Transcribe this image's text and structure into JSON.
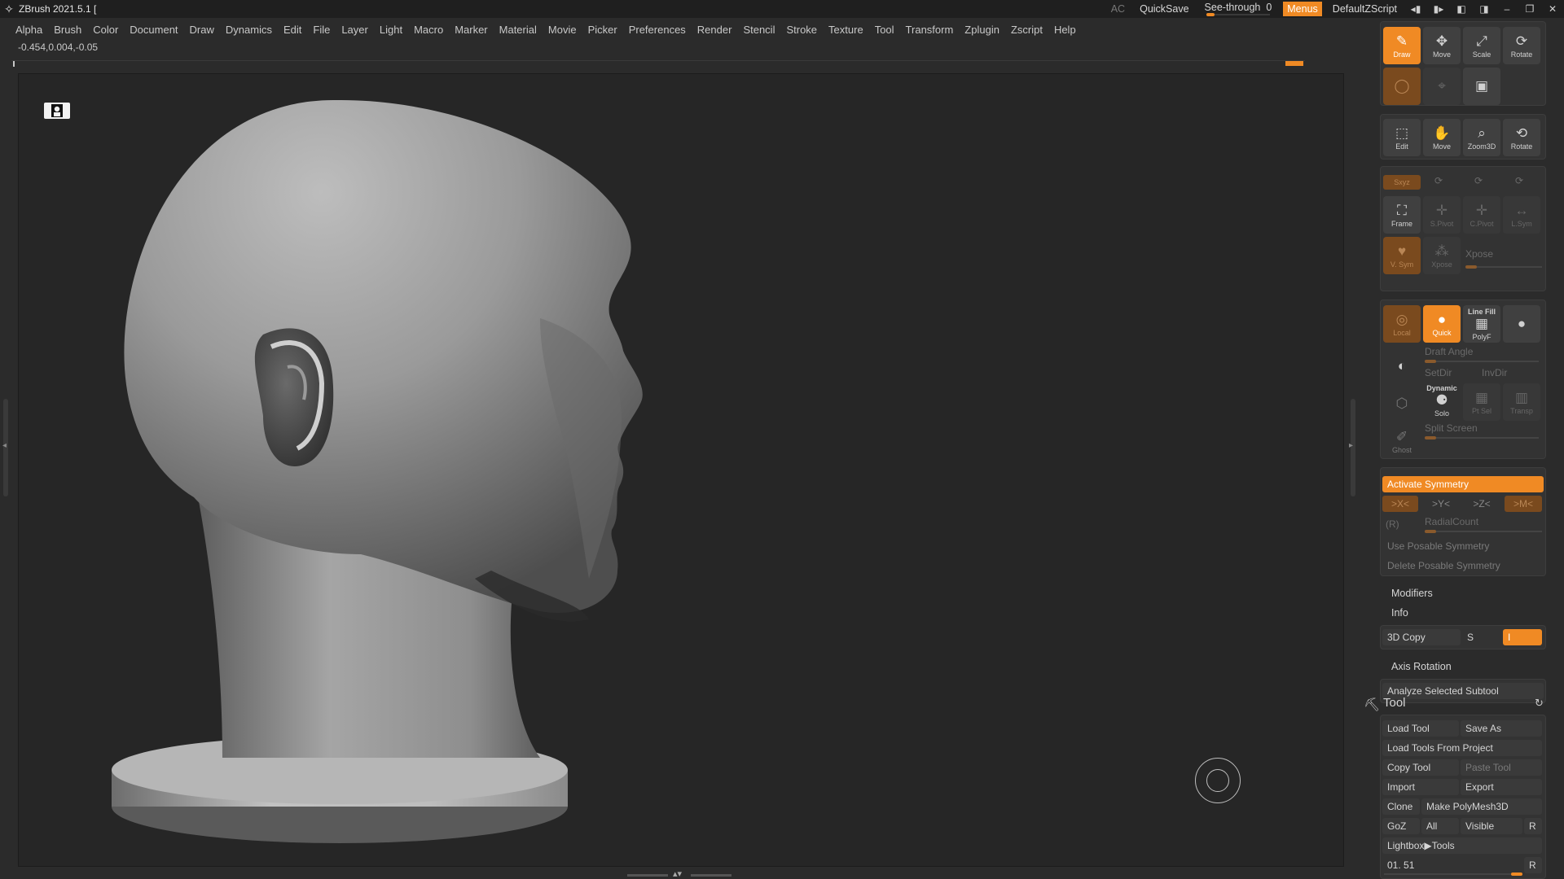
{
  "titlebar": {
    "app_title": "ZBrush 2021.5.1 [",
    "ac": "AC",
    "quicksave": "QuickSave",
    "seethrough_label": "See-through",
    "seethrough_value": "0",
    "menus": "Menus",
    "script": "DefaultZScript"
  },
  "menubar": [
    "Alpha",
    "Brush",
    "Color",
    "Document",
    "Draw",
    "Dynamics",
    "Edit",
    "File",
    "Layer",
    "Light",
    "Macro",
    "Marker",
    "Material",
    "Movie",
    "Picker",
    "Preferences",
    "Render",
    "Stencil",
    "Stroke",
    "Texture",
    "Tool",
    "Transform",
    "Zplugin",
    "Zscript",
    "Help"
  ],
  "coords": "-0.454,0.004,-0.05",
  "shelf": {
    "draw": "Draw",
    "move": "Move",
    "scale": "Scale",
    "rotate": "Rotate",
    "edit": "Edit",
    "move2": "Move",
    "zoom3d": "Zoom3D",
    "rotate2": "Rotate",
    "xyz": "Sxyz",
    "frame": "Frame",
    "spivot": "S.Pivot",
    "cpivot": "C.Pivot",
    "lsym": "L.Sym",
    "vsym": "V. Sym",
    "xpose_btn": "Xpose",
    "xpose": "Xpose",
    "local": "Local",
    "quick": "Quick",
    "linefill": "Line Fill",
    "polyf": "PolyF",
    "draft_angle": "Draft Angle",
    "setdir": "SetDir",
    "invdir": "InvDir",
    "dynamic": "Dynamic",
    "solo": "Solo",
    "ptsel": "Pt Sel",
    "transp": "Transp",
    "split_screen": "Split Screen",
    "ghost": "Ghost"
  },
  "symmetry": {
    "activate": "Activate Symmetry",
    "x": ">X<",
    "y": ">Y<",
    "z": ">Z<",
    "m": ">M<",
    "r": "(R)",
    "radialcount": "RadialCount",
    "use_posable": "Use Posable Symmetry",
    "delete_posable": "Delete Posable Symmetry"
  },
  "modifiers": "Modifiers",
  "info": "Info",
  "copy3d": "3D Copy",
  "copy3d_s": "S",
  "copy3d_field": "I",
  "axis_rotation": "Axis Rotation",
  "analyze": "Analyze Selected Subtool",
  "tool": {
    "header": "Tool",
    "load_tool": "Load Tool",
    "save_as": "Save As",
    "load_from_project": "Load Tools From Project",
    "copy_tool": "Copy Tool",
    "paste_tool": "Paste Tool",
    "import": "Import",
    "export": "Export",
    "clone": "Clone",
    "make_polymesh": "Make PolyMesh3D",
    "goz": "GoZ",
    "all": "All",
    "visible": "Visible",
    "r": "R",
    "lightbox": "Lightbox▶Tools",
    "value": "01. 51",
    "value_r": "R"
  },
  "colors": {
    "accent": "#f08a24",
    "bg": "#2b2b2b",
    "canvas": "#262626"
  }
}
